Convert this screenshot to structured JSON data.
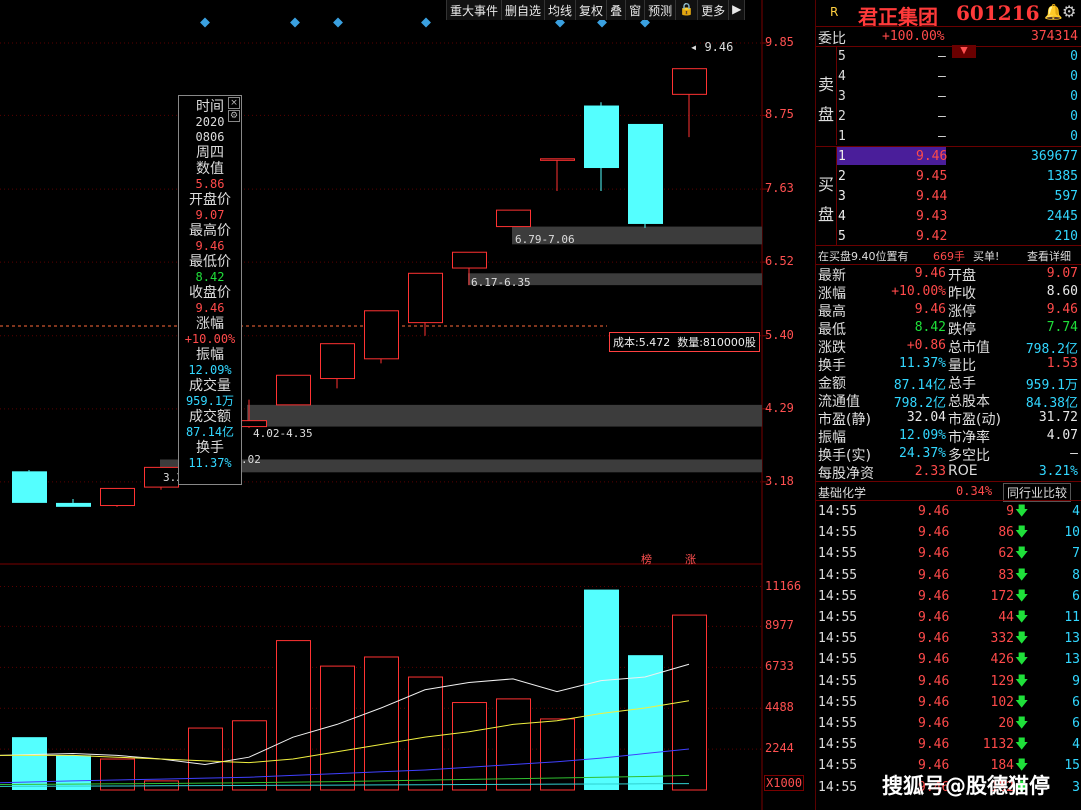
{
  "toolbar": [
    "重大事件",
    "删自选",
    "均线",
    "复权",
    "叠",
    "窗",
    "预测",
    "🔒",
    "更多",
    "▶"
  ],
  "price_axis": [
    "9.85",
    "8.75",
    "7.63",
    "6.52",
    "5.40",
    "4.29",
    "3.18"
  ],
  "volume_axis": [
    "11166",
    "8977",
    "6733",
    "4488",
    "2244",
    "X1000"
  ],
  "tooltip": {
    "time_label": "时间",
    "year": "2020",
    "date": "0806",
    "weekday": "周四",
    "value_label": "数值",
    "value": "5.86",
    "open_label": "开盘价",
    "open": "9.07",
    "high_label": "最高价",
    "high": "9.46",
    "low_label": "最低价",
    "low": "8.42",
    "close_label": "收盘价",
    "close": "9.46",
    "chg_label": "涨幅",
    "chg": "+10.00%",
    "amp_label": "振幅",
    "amp": "12.09%",
    "vol_label": "成交量",
    "vol": "959.1万",
    "amt_label": "成交额",
    "amt": "87.14亿",
    "turn_label": "换手",
    "turn": "11.37%"
  },
  "annotations": {
    "high_marker": "9.46",
    "gap1": "6.79-7.06",
    "gap2": "6.17-6.35",
    "gap3": "4.02-4.35",
    "gap4_partial": ".02",
    "gap5_partial": "3.3",
    "cost_box": "成本:5.472  数量:810000股",
    "tag_bang": "榜",
    "tag_zhang": "涨"
  },
  "chart_data": {
    "type": "candlestick",
    "price_ylim": [
      2.6,
      10.2
    ],
    "volume_ylim": [
      0,
      11800
    ],
    "candles": [
      {
        "o": 3.34,
        "h": 3.36,
        "l": 2.86,
        "c": 2.86,
        "v": 2900
      },
      {
        "o": 2.86,
        "h": 2.92,
        "l": 2.8,
        "c": 2.8,
        "v": 1900
      },
      {
        "o": 2.82,
        "h": 3.08,
        "l": 2.8,
        "c": 3.08,
        "v": 1700
      },
      {
        "o": 3.1,
        "h": 3.4,
        "l": 3.06,
        "c": 3.4,
        "v": 500
      },
      {
        "o": 3.4,
        "h": 3.75,
        "l": 3.38,
        "c": 3.74,
        "v": 3400
      },
      {
        "o": 4.02,
        "h": 4.43,
        "l": 4.0,
        "c": 4.11,
        "v": 3800
      },
      {
        "o": 4.35,
        "h": 4.8,
        "l": 4.35,
        "c": 4.8,
        "v": 8200
      },
      {
        "o": 4.75,
        "h": 5.28,
        "l": 4.6,
        "c": 5.28,
        "v": 6800
      },
      {
        "o": 5.05,
        "h": 5.78,
        "l": 4.98,
        "c": 5.78,
        "v": 7300
      },
      {
        "o": 5.6,
        "h": 6.35,
        "l": 5.4,
        "c": 6.35,
        "v": 6200
      },
      {
        "o": 6.43,
        "h": 6.67,
        "l": 6.17,
        "c": 6.67,
        "v": 4800
      },
      {
        "o": 7.06,
        "h": 7.31,
        "l": 7.06,
        "c": 7.31,
        "v": 5000
      },
      {
        "o": 8.09,
        "h": 8.09,
        "l": 7.6,
        "c": 8.09,
        "v": 3900
      },
      {
        "o": 8.9,
        "h": 8.95,
        "l": 7.6,
        "c": 7.95,
        "v": 11000
      },
      {
        "o": 8.62,
        "h": 8.62,
        "l": 7.04,
        "c": 7.1,
        "v": 7400
      },
      {
        "o": 9.07,
        "h": 9.46,
        "l": 8.42,
        "c": 9.46,
        "v": 9600
      }
    ],
    "volume_ma1": [
      1900,
      2000,
      1900,
      1700,
      1400,
      1800,
      2900,
      3600,
      4500,
      5500,
      5900,
      6100,
      5400,
      6000,
      6200,
      6900
    ],
    "volume_ma2": [
      1900,
      1900,
      1800,
      1700,
      1600,
      1500,
      1700,
      2100,
      2500,
      2900,
      3200,
      3600,
      3800,
      4200,
      4500,
      4900
    ],
    "volume_ma3": [
      400,
      500,
      550,
      600,
      650,
      700,
      800,
      900,
      1000,
      1100,
      1250,
      1400,
      1550,
      1750,
      2000,
      2250
    ],
    "volume_ma4": [
      300,
      320,
      340,
      360,
      380,
      400,
      430,
      460,
      500,
      540,
      580,
      620,
      660,
      700,
      740,
      800
    ],
    "volume_ma5": [
      200,
      210,
      220,
      230,
      240,
      250,
      260,
      270,
      280,
      290,
      300,
      310,
      320,
      330,
      340,
      350
    ]
  },
  "colors": {
    "up": "#ff3232",
    "down": "#54ffff",
    "ma_white": "#f0f0f0",
    "ma_yellow": "#f0f040",
    "ma_blue": "#4040ff",
    "ma_green": "#30c030",
    "ma_cyan": "#30d0d0"
  },
  "stock": {
    "r_tag": "R",
    "name": "君正集团",
    "code": "601216"
  },
  "weibi": {
    "label": "委比",
    "pct": "+100.00%",
    "value": "374314"
  },
  "side_labels": {
    "sell_1": "卖",
    "sell_2": "盘",
    "buy_1": "买",
    "buy_2": "盘"
  },
  "sell_orders": [
    {
      "lvl": "5",
      "price": "–",
      "vol": "0"
    },
    {
      "lvl": "4",
      "price": "–",
      "vol": "0"
    },
    {
      "lvl": "3",
      "price": "–",
      "vol": "0"
    },
    {
      "lvl": "2",
      "price": "–",
      "vol": "0"
    },
    {
      "lvl": "1",
      "price": "–",
      "vol": "0"
    }
  ],
  "buy_orders": [
    {
      "lvl": "1",
      "price": "9.46",
      "vol": "369677"
    },
    {
      "lvl": "2",
      "price": "9.45",
      "vol": "1385"
    },
    {
      "lvl": "3",
      "price": "9.44",
      "vol": "597"
    },
    {
      "lvl": "4",
      "price": "9.43",
      "vol": "2445"
    },
    {
      "lvl": "5",
      "price": "9.42",
      "vol": "210"
    }
  ],
  "queue": {
    "text": "在买盘9.40位置有",
    "count": "669手",
    "buy_btn": "买单!",
    "detail_btn": "查看详细"
  },
  "stats": [
    {
      "l1": "最新",
      "v1": "9.46",
      "c1": "red",
      "l2": "开盘",
      "v2": "9.07",
      "c2": "red"
    },
    {
      "l1": "涨幅",
      "v1": "+10.00%",
      "c1": "red",
      "l2": "昨收",
      "v2": "8.60",
      "c2": "white"
    },
    {
      "l1": "最高",
      "v1": "9.46",
      "c1": "red",
      "l2": "涨停",
      "v2": "9.46",
      "c2": "red"
    },
    {
      "l1": "最低",
      "v1": "8.42",
      "c1": "green",
      "l2": "跌停",
      "v2": "7.74",
      "c2": "green"
    },
    {
      "l1": "涨跌",
      "v1": "+0.86",
      "c1": "red",
      "l2": "总市值",
      "v2": "798.2亿",
      "c2": "cyan"
    },
    {
      "l1": "换手",
      "v1": "11.37%",
      "c1": "cyan",
      "l2": "量比",
      "v2": "1.53",
      "c2": "red"
    },
    {
      "l1": "金额",
      "v1": "87.14亿",
      "c1": "cyan",
      "l2": "总手",
      "v2": "959.1万",
      "c2": "cyan"
    },
    {
      "l1": "流通值",
      "v1": "798.2亿",
      "c1": "cyan",
      "l2": "总股本",
      "v2": "84.38亿",
      "c2": "cyan"
    },
    {
      "l1": "市盈(静)",
      "v1": "32.04",
      "c1": "white",
      "l2": "市盈(动)",
      "v2": "31.72",
      "c2": "white"
    },
    {
      "l1": "振幅",
      "v1": "12.09%",
      "c1": "cyan",
      "l2": "市净率",
      "v2": "4.07",
      "c2": "white"
    },
    {
      "l1": "换手(实)",
      "v1": "24.37%",
      "c1": "cyan",
      "l2": "多空比",
      "v2": "–",
      "c2": "white"
    },
    {
      "l1": "每股净资",
      "v1": "2.33",
      "c1": "red",
      "l2": "ROE",
      "v2": "3.21%",
      "c2": "cyan"
    }
  ],
  "sector": {
    "name": "基础化学",
    "pct": "0.34%",
    "btn": "同行业比较"
  },
  "ticks": [
    {
      "t": "14:55",
      "p": "9.46",
      "v": "9",
      "n": "4"
    },
    {
      "t": "14:55",
      "p": "9.46",
      "v": "86",
      "n": "10"
    },
    {
      "t": "14:55",
      "p": "9.46",
      "v": "62",
      "n": "7"
    },
    {
      "t": "14:55",
      "p": "9.46",
      "v": "83",
      "n": "8"
    },
    {
      "t": "14:55",
      "p": "9.46",
      "v": "172",
      "n": "6"
    },
    {
      "t": "14:55",
      "p": "9.46",
      "v": "44",
      "n": "11"
    },
    {
      "t": "14:55",
      "p": "9.46",
      "v": "332",
      "n": "13"
    },
    {
      "t": "14:55",
      "p": "9.46",
      "v": "426",
      "n": "13"
    },
    {
      "t": "14:55",
      "p": "9.46",
      "v": "129",
      "n": "9"
    },
    {
      "t": "14:55",
      "p": "9.46",
      "v": "102",
      "n": "6"
    },
    {
      "t": "14:55",
      "p": "9.46",
      "v": "20",
      "n": "6"
    },
    {
      "t": "14:55",
      "p": "9.46",
      "v": "1132",
      "n": "4"
    },
    {
      "t": "14:55",
      "p": "9.46",
      "v": "184",
      "n": "15"
    },
    {
      "t": "14:55",
      "p": "9.46",
      "v": "182",
      "n": "3"
    }
  ],
  "watermark": "搜狐号@股德猫停"
}
